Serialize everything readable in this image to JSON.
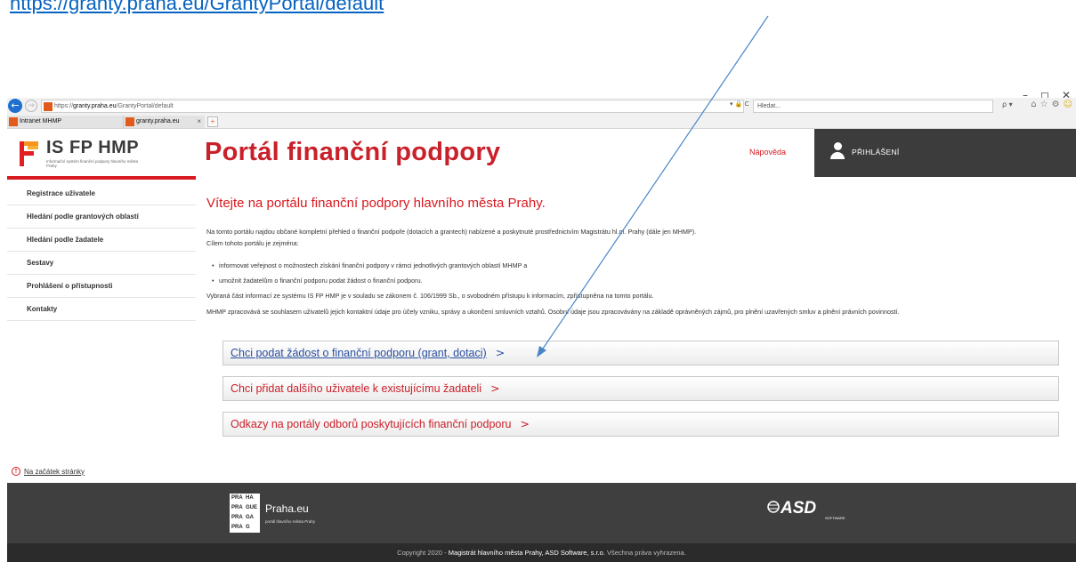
{
  "top_link": "https://granty.praha.eu/GrantyPortal/default",
  "browser": {
    "window_controls": [
      "–",
      "◻",
      "✕"
    ],
    "back_glyph": "←",
    "forward_glyph": "→",
    "address_prefix": "https://",
    "address_domain": "granty.praha.eu",
    "address_path": "/GrantyPortal/default",
    "address_controls": "▾ 🔒 C",
    "search_placeholder": "Hledat...",
    "search_controls": "ρ ▾",
    "toolbar_icons": [
      "⌂",
      "☆",
      "⚙",
      "☺"
    ],
    "tabs": [
      {
        "label": "Intranet MHMP"
      },
      {
        "label": "granty.praha.eu",
        "close": "×"
      }
    ],
    "new_tab_glyph": "+"
  },
  "header": {
    "logo_title": "IS FP HMP",
    "logo_subtitle": "Informační systém finanční podpory hlavního města Prahy",
    "portal_title": "Portál finanční podpory",
    "help_link": "Nápověda",
    "login_label": "PŘIHLÁŠENÍ"
  },
  "sidebar": {
    "items": [
      {
        "label": "Registrace uživatele"
      },
      {
        "label": "Hledání podle grantových oblastí"
      },
      {
        "label": "Hledání podle žadatele"
      },
      {
        "label": "Sestavy"
      },
      {
        "label": "Prohlášení o přístupnosti"
      },
      {
        "label": "Kontakty"
      }
    ]
  },
  "main": {
    "welcome": "Vítejte na portálu finanční podpory hlavního města Prahy.",
    "intro": "Na tomto portálu najdou občané kompletní přehled o finanční podpoře (dotacích a grantech) nabízené a poskytnuté prostřednictvím Magistrátu hl.m. Prahy (dále jen MHMP).",
    "goal_intro": "Cílem tohoto portálu je zejména:",
    "bullets": [
      "informovat veřejnost o možnostech získání finanční podpory v rámci jednotlivých grantových oblastí MHMP a",
      "umožnit žadatelům o finanční podporu podat žádost o finanční podporu."
    ],
    "law_note": "Vybraná část informací ze systému IS FP HMP je v souladu se zákonem č. 106/1999 Sb., o svobodném přístupu k informacím, zpřístupněna na tomto portálu.",
    "gdpr_note": "MHMP zpracovává se souhlasem uživatelů jejich kontaktní údaje pro účely vzniku, správy a ukončení smluvních vztahů. Osobní údaje jsou zpracovávány na základě oprávněných zájmů, pro plnění uzavřených smluv a plnění právních povinností.",
    "actions": [
      {
        "label": "Chci podat žádost o finanční podporu (grant, dotaci)",
        "chevron": ">"
      },
      {
        "label": "Chci přidat dalšího uživatele k existujícímu žadateli",
        "chevron": ">"
      },
      {
        "label": "Odkazy na portály odborů poskytujících finanční podporu",
        "chevron": ">"
      }
    ]
  },
  "back_to_top": {
    "glyph": "↑",
    "label": "Na začátek stránky"
  },
  "footer": {
    "praha_grid": [
      "PRA",
      "HA",
      "PRA",
      "GUE",
      "PRA",
      "GA",
      "PRA",
      "G"
    ],
    "praha_name": "Praha.eu",
    "praha_subtitle": "portál hlavního města Prahy",
    "asd_logo": "ASD",
    "asd_logo_sub": "SOFTWARE",
    "copyright_prefix": "Copyright 2020 - ",
    "copyright_owners": "Magistrát hlavního města Prahy, ASD Software, s.r.o.",
    "copyright_suffix": " Všechna práva vyhrazena."
  },
  "colors": {
    "brand_red": "#d71920",
    "title_red": "#c9202a",
    "link_blue": "#2a4fa0",
    "annotation_arrow": "#4a86c8"
  }
}
